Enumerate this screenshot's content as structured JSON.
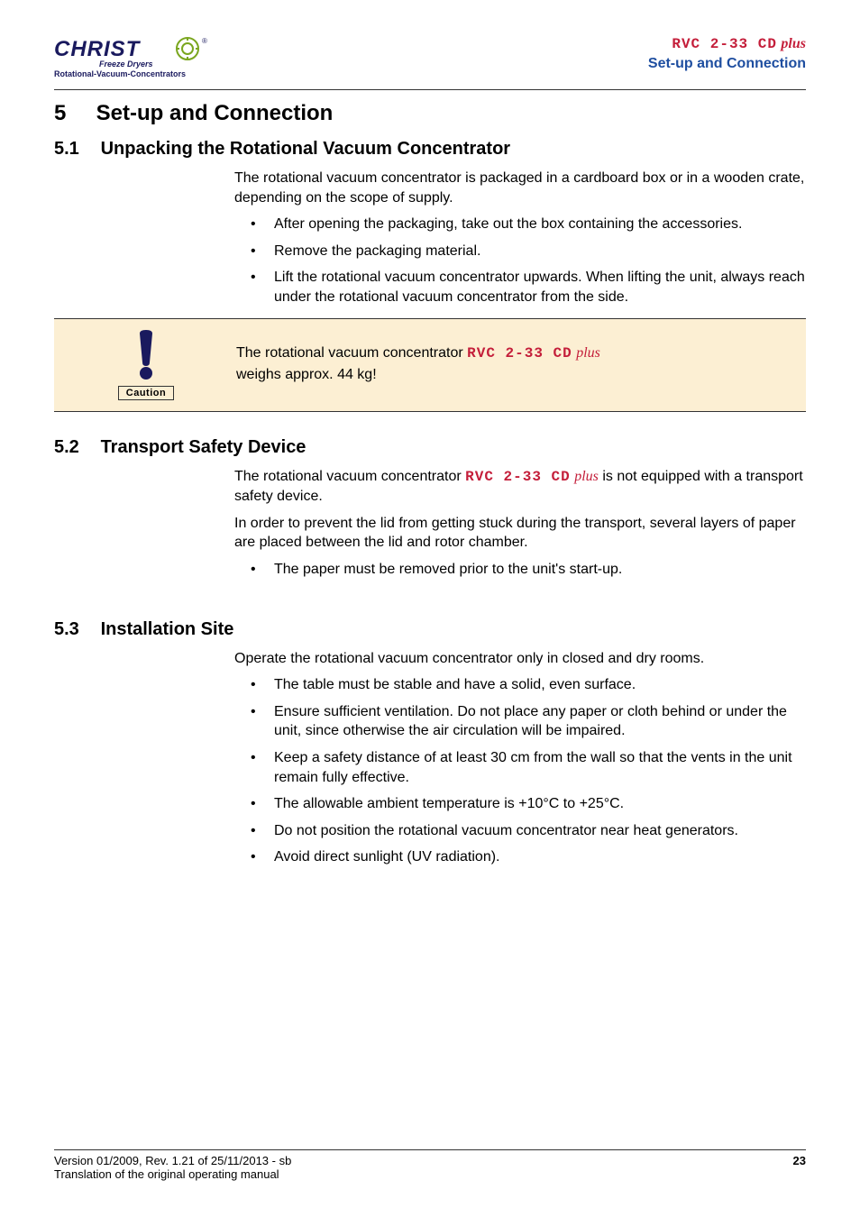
{
  "header": {
    "logo_main": "CHRIST",
    "logo_line1": "Freeze Dryers",
    "logo_line2": "Rotational-Vacuum-Concentrators",
    "product_prefix": "RVC 2-33 CD",
    "product_suffix": "plus",
    "section_title": "Set-up and Connection"
  },
  "h1": {
    "num": "5",
    "title": "Set-up and Connection"
  },
  "s51": {
    "num": "5.1",
    "title": "Unpacking the Rotational Vacuum Concentrator",
    "p1": "The rotational vacuum concentrator is packaged in a cardboard box or in a wooden crate, depending on the scope of supply.",
    "b1": "After opening the packaging, take out the box containing the accessories.",
    "b2": "Remove the packaging material.",
    "b3": "Lift the rotational vacuum concentrator upwards. When lifting the unit, always reach under the rotational vacuum concentrator from the side."
  },
  "caution": {
    "label": "Caution",
    "t1": "The rotational vacuum concentrator ",
    "inline_prefix": " RVC 2-33 CD",
    "inline_suffix": "plus",
    "t2": "weighs approx. 44 kg!"
  },
  "s52": {
    "num": "5.2",
    "title": "Transport Safety Device",
    "p1a": "The rotational vacuum concentrator ",
    "inline_prefix": "RVC 2-33 CD",
    "inline_suffix": "plus",
    "p1b": " is not equipped with a transport safety device.",
    "p2": "In order to prevent the lid from getting stuck during the transport, several layers of paper are placed between the lid and rotor chamber.",
    "b1": "The paper must be removed prior to the unit's start-up."
  },
  "s53": {
    "num": "5.3",
    "title": "Installation Site",
    "p1": "Operate the rotational vacuum concentrator only in closed and dry rooms.",
    "b1": "The table must be stable and have a solid, even surface.",
    "b2": "Ensure sufficient ventilation. Do not place any paper or cloth behind or under the unit, since otherwise the air circulation will be impaired.",
    "b3": "Keep a safety distance of at least 30 cm from the wall so that the vents in the unit remain fully effective.",
    "b4": "The allowable ambient temperature  is +10°C to +25°C.",
    "b5": "Do not position the rotational vacuum concentrator near heat generators.",
    "b6": "Avoid direct sunlight (UV radiation)."
  },
  "footer": {
    "left1": "Version 01/2009, Rev. 1.21 of 25/11/2013 - sb",
    "left2": "Translation of the original operating manual",
    "page": "23"
  }
}
